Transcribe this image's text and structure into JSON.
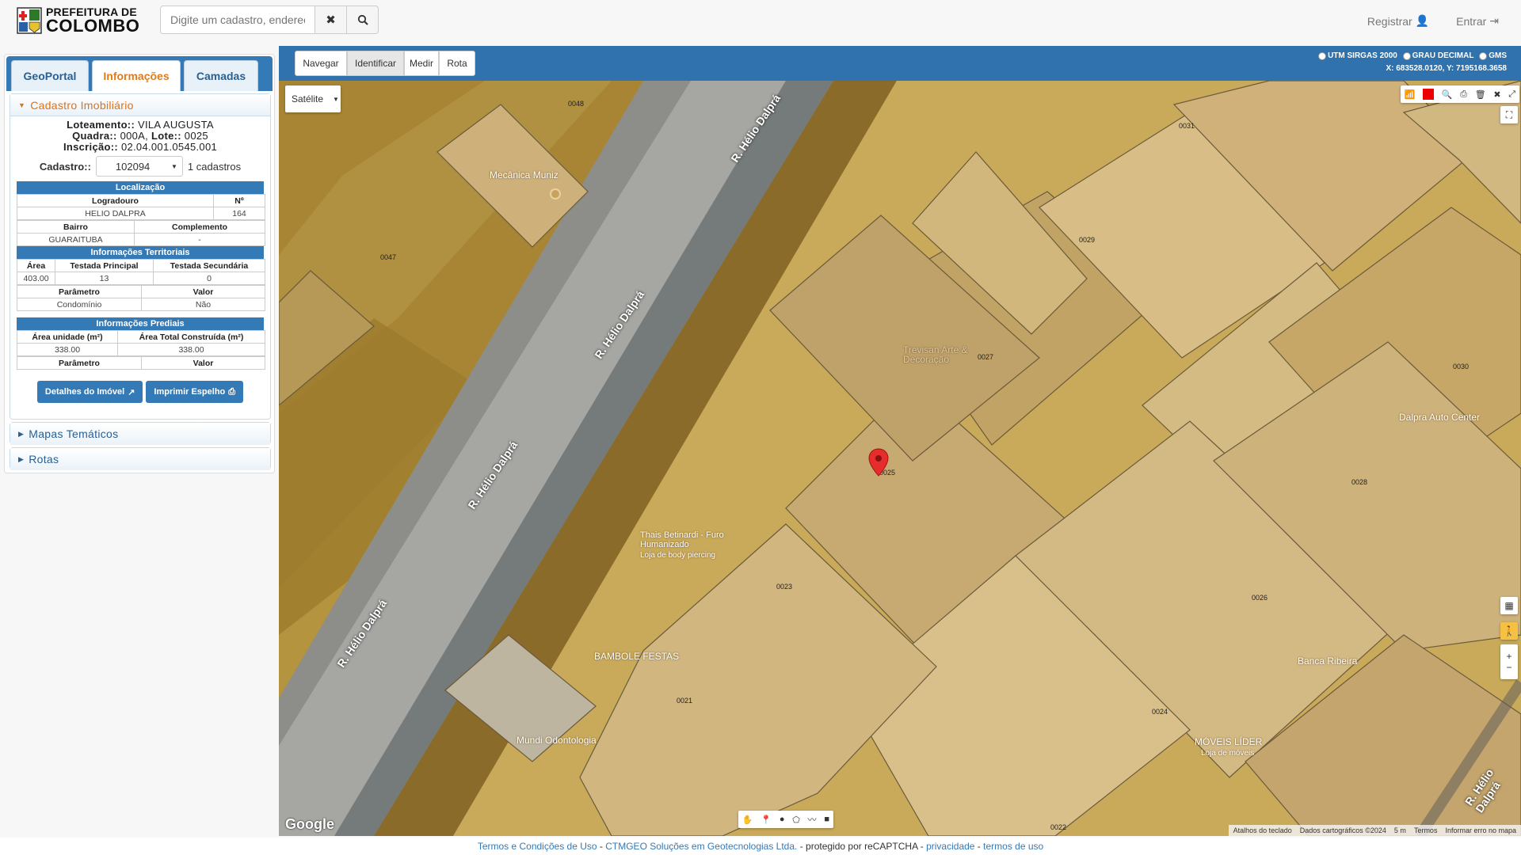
{
  "header": {
    "logo_line1": "PREFEITURA DE",
    "logo_line2": "COLOMBO",
    "search_placeholder": "Digite um cadastro, endereço...",
    "nav_register": "Registrar",
    "nav_login": "Entrar"
  },
  "left_tabs": [
    "GeoPortal",
    "Informações",
    "Camadas"
  ],
  "cadastro": {
    "title": "Cadastro Imobiliário",
    "loteamento_label": "Loteamento::",
    "loteamento": "VILA AUGUSTA",
    "quadra_label": "Quadra::",
    "quadra": "000A",
    "lote_label": "Lote::",
    "lote": "0025",
    "inscricao_label": "Inscrição::",
    "inscricao": "02.04.001.0545.001",
    "cadastro_label": "Cadastro::",
    "cadastro_value": "102094",
    "cadastro_count": "1 cadastros"
  },
  "localizacao": {
    "title": "Localização",
    "h_logradouro": "Logradouro",
    "h_numero": "Nº",
    "logradouro": "HELIO DALPRA",
    "numero": "164",
    "h_bairro": "Bairro",
    "h_complemento": "Complemento",
    "bairro": "GUARAITUBA",
    "complemento": "-"
  },
  "territoriais": {
    "title": "Informações Territoriais",
    "h_area": "Área",
    "h_testada_principal": "Testada Principal",
    "h_testada_secundaria": "Testada Secundária",
    "area": "403.00",
    "testada_principal": "13",
    "testada_secundaria": "0",
    "h_parametro": "Parâmetro",
    "h_valor": "Valor",
    "parametro": "Condomínio",
    "valor": "Não"
  },
  "prediais": {
    "title": "Informações Prediais",
    "h_area_unidade": "Área unidade (m²)",
    "h_area_total": "Área Total Construída (m²)",
    "area_unidade": "338.00",
    "area_total": "338.00",
    "h_parametro": "Parâmetro",
    "h_valor": "Valor"
  },
  "buttons": {
    "detalhes": "Detalhes do Imóvel",
    "imprimir": "Imprimir Espelho"
  },
  "accordion": {
    "mapas": "Mapas Temáticos",
    "rotas": "Rotas"
  },
  "map_toolbar": {
    "navegar": "Navegar",
    "identificar": "Identificar",
    "medir": "Medir",
    "rota": "Rota",
    "opt_utm": "UTM SIRGAS 2000",
    "opt_grau": "GRAU DECIMAL",
    "opt_gms": "GMS",
    "coords": "X: 683528.0120, Y: 7195168.3658"
  },
  "map": {
    "basemap": "Satélite",
    "google_logo": "Google",
    "streets": [
      "R. Hélio Dalprá",
      "R. Hélio Dalprá",
      "R. Hélio Dalprá",
      "R. Hélio Dalprá",
      "R. Hélio Dalprá"
    ],
    "pois": [
      "Mecânica Muniz",
      "Trevisan Arte & Decoração",
      "Thais Betinardi - Furo Humanizado",
      "Loja de body piercing",
      "BAMBOLE FESTAS",
      "Mundi Odontologia",
      "Dalpra Auto Center",
      "Banca Ribeira",
      "MÓVEIS LÍDER",
      "Loja de móveis"
    ],
    "lots": [
      "0048",
      "0047",
      "0031",
      "0029",
      "0027",
      "0030",
      "0025",
      "0028",
      "0023",
      "0026",
      "0021",
      "0024",
      "0022"
    ],
    "watermark": "©2024 Google",
    "attrib": [
      "Atalhos do teclado",
      "Dados cartográficos ©2024",
      "5 m",
      "Termos",
      "Informar erro no mapa"
    ]
  },
  "footer": {
    "termos": "Termos e Condições de Uso",
    "sep1": " - ",
    "ctmgeo": "CTMGEO Soluções em Geotecnologias Ltda.",
    "recaptcha": " - protegido por reCAPTCHA - ",
    "privacidade": "privacidade",
    "sep2": " - ",
    "termos_uso": "termos de uso"
  }
}
